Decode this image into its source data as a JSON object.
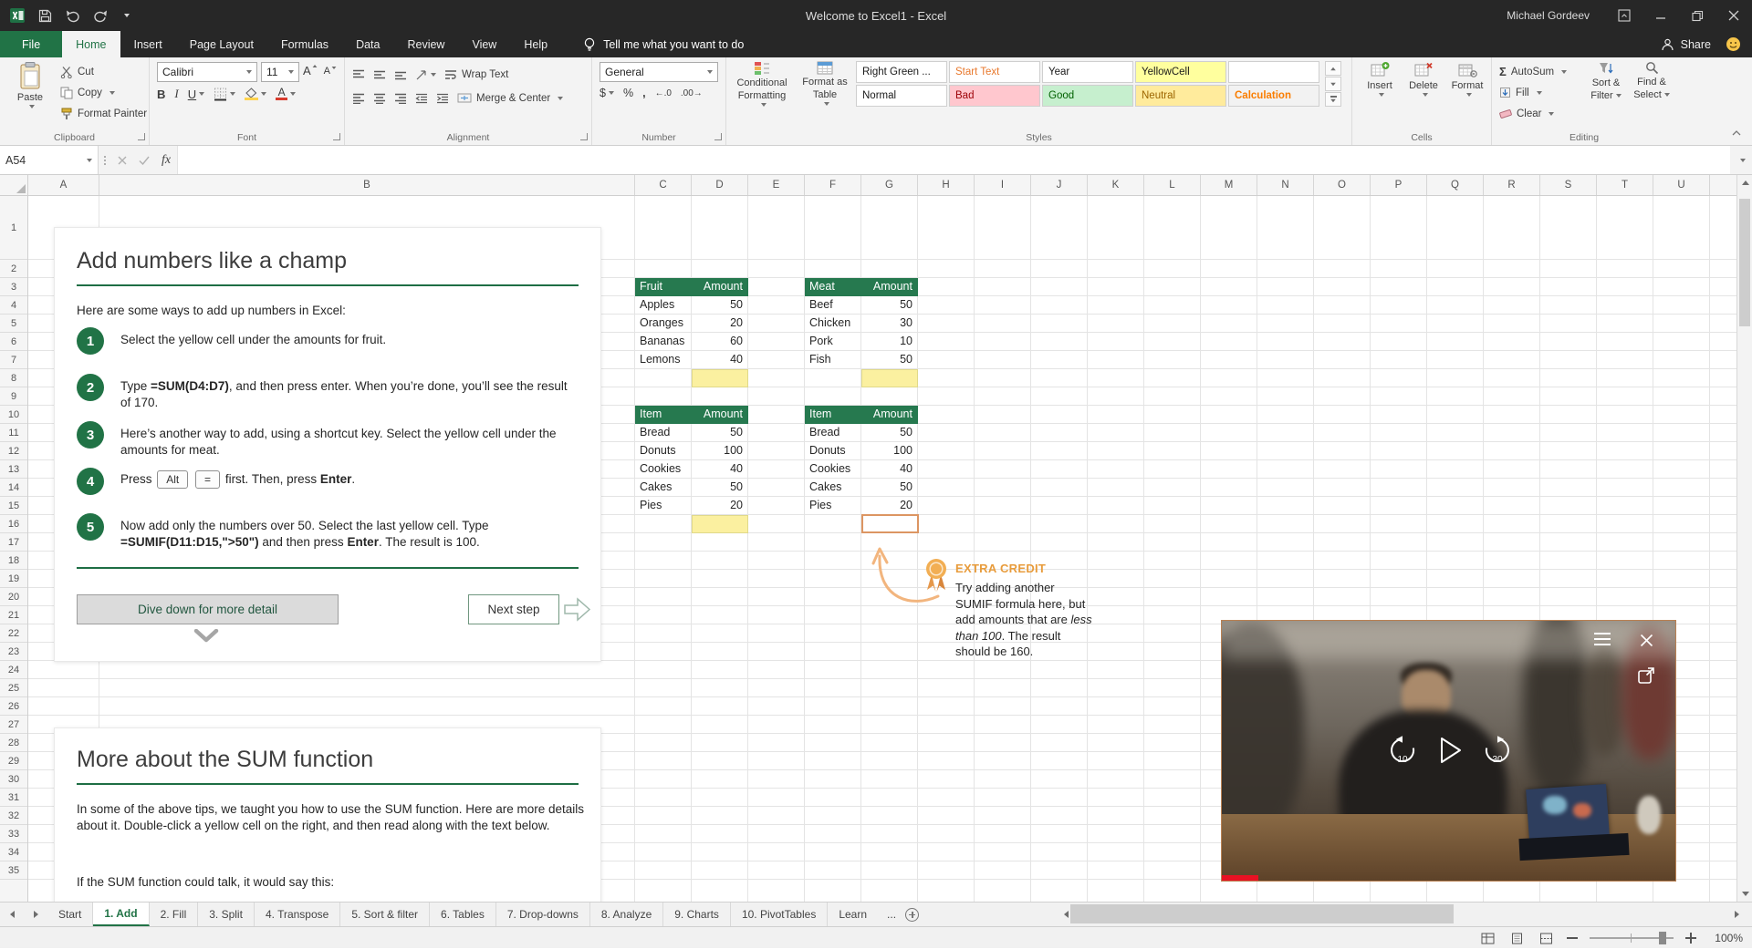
{
  "titlebar": {
    "title": "Welcome to Excel1 - Excel",
    "user": "Michael Gordeev"
  },
  "nav": {
    "file": "File",
    "tabs": [
      "Home",
      "Insert",
      "Page Layout",
      "Formulas",
      "Data",
      "Review",
      "View",
      "Help"
    ],
    "tell_me": "Tell me what you want to do",
    "share": "Share"
  },
  "ribbon": {
    "clipboard": {
      "label": "Clipboard",
      "paste": "Paste",
      "cut": "Cut",
      "copy": "Copy",
      "format_painter": "Format Painter"
    },
    "font": {
      "label": "Font",
      "name": "Calibri",
      "size": "11",
      "bold": "B",
      "italic": "I",
      "underline": "U"
    },
    "alignment": {
      "label": "Alignment",
      "wrap": "Wrap Text",
      "merge": "Merge & Center"
    },
    "number": {
      "label": "Number",
      "format": "General",
      "currency": "$",
      "percent": "%",
      "comma": ",",
      "inc_decimal": "←.0",
      "dec_decimal": ".00→"
    },
    "styles": {
      "label": "Styles",
      "conditional_1": "Conditional",
      "conditional_2": "Formatting",
      "format_table_1": "Format as",
      "format_table_2": "Table",
      "gallery": [
        {
          "name": "Right Green ...",
          "bg": "#ffffff",
          "color": "#1a1a1a",
          "bold": false
        },
        {
          "name": "Start Text",
          "bg": "#ffffff",
          "color": "#e8782c",
          "bold": false
        },
        {
          "name": "Year",
          "bg": "#ffffff",
          "color": "#1a1a1a",
          "bold": false
        },
        {
          "name": "YellowCell",
          "bg": "#ffff9e",
          "color": "#1a1a1a",
          "bold": false
        },
        {
          "name": "",
          "bg": "#ffffff",
          "color": "#1a1a1a",
          "bold": false
        },
        {
          "name": "Normal",
          "bg": "#ffffff",
          "color": "#1a1a1a",
          "bold": false
        },
        {
          "name": "Bad",
          "bg": "#ffc7ce",
          "color": "#9c0006",
          "bold": false
        },
        {
          "name": "Good",
          "bg": "#c6efce",
          "color": "#006100",
          "bold": false
        },
        {
          "name": "Neutral",
          "bg": "#ffeb9c",
          "color": "#9c6500",
          "bold": false
        },
        {
          "name": "Calculation",
          "bg": "#f2f2f2",
          "color": "#fa7d00",
          "bold": true
        }
      ]
    },
    "cells": {
      "label": "Cells",
      "insert": "Insert",
      "delete": "Delete",
      "format": "Format"
    },
    "editing": {
      "label": "Editing",
      "sigma": "Σ",
      "autosum": "AutoSum",
      "fill": "Fill",
      "clear": "Clear",
      "sort_1": "Sort &",
      "sort_2": "Filter",
      "find_1": "Find &",
      "find_2": "Select"
    }
  },
  "formula_bar": {
    "name_box": "A54",
    "fx": "fx",
    "formula": ""
  },
  "grid": {
    "columns": [
      "A",
      "B",
      "C",
      "D",
      "E",
      "F",
      "G",
      "H",
      "I",
      "J",
      "K",
      "L",
      "M",
      "N",
      "O",
      "P",
      "Q",
      "R",
      "S",
      "T",
      "U"
    ],
    "rows": 35
  },
  "content": {
    "card1": {
      "title": "Add numbers like a champ",
      "intro": "Here are some ways to add up numbers in Excel:",
      "step1_n": "1",
      "step1": "Select the yellow cell under the amounts for fruit.",
      "step2_n": "2",
      "step2_a": "Type ",
      "step2_b": "=SUM(D4:D7)",
      "step2_c": ", and then press enter. When you’re done, you’ll see the result of 170.",
      "step3_n": "3",
      "step3": "Here’s another way to add, using a shortcut key. Select the yellow cell under the amounts for meat.",
      "step4_n": "4",
      "step4_a": "Press ",
      "step4_key1": "Alt",
      "step4_key2": "=",
      "step4_b": " first. Then, press ",
      "step4_c": "Enter",
      "step4_d": ".",
      "step5_n": "5",
      "step5_a": "Now add only the numbers over 50. Select the last yellow cell. Type ",
      "step5_b": "=SUMIF(D11:D15,\">50\")",
      "step5_c": " and then press ",
      "step5_d": "Enter",
      "step5_e": ". The result is 100.",
      "dive_button": "Dive down for more detail",
      "next_button": "Next step"
    },
    "tables": {
      "fruit": {
        "h1": "Fruit",
        "h2": "Amount",
        "rows": [
          [
            "Apples",
            "50"
          ],
          [
            "Oranges",
            "20"
          ],
          [
            "Bananas",
            "60"
          ],
          [
            "Lemons",
            "40"
          ]
        ]
      },
      "meat": {
        "h1": "Meat",
        "h2": "Amount",
        "rows": [
          [
            "Beef",
            "50"
          ],
          [
            "Chicken",
            "30"
          ],
          [
            "Pork",
            "10"
          ],
          [
            "Fish",
            "50"
          ]
        ]
      },
      "items1": {
        "h1": "Item",
        "h2": "Amount",
        "rows": [
          [
            "Bread",
            "50"
          ],
          [
            "Donuts",
            "100"
          ],
          [
            "Cookies",
            "40"
          ],
          [
            "Cakes",
            "50"
          ],
          [
            "Pies",
            "20"
          ]
        ]
      },
      "items2": {
        "h1": "Item",
        "h2": "Amount",
        "rows": [
          [
            "Bread",
            "50"
          ],
          [
            "Donuts",
            "100"
          ],
          [
            "Cookies",
            "40"
          ],
          [
            "Cakes",
            "50"
          ],
          [
            "Pies",
            "20"
          ]
        ]
      }
    },
    "extra_credit": {
      "title": "EXTRA CREDIT",
      "t1": "Try adding another SUMIF formula here, but add amounts that are ",
      "t2": "less than 100",
      "t3": ". The result should be 160."
    },
    "card2": {
      "title": "More about the SUM function",
      "p1": "In some of the above tips, we taught you how to use the SUM function. Here are more details about it. Double-click a yellow cell on the right, and then read along with the text below.",
      "p2": "If the SUM function could talk, it would say this:"
    },
    "video": {
      "rewind": "10",
      "forward": "30"
    }
  },
  "sheet_tabs": {
    "items": [
      "Start",
      "1. Add",
      "2. Fill",
      "3. Split",
      "4. Transpose",
      "5. Sort & filter",
      "6. Tables",
      "7. Drop-downs",
      "8. Analyze",
      "9. Charts",
      "10. PivotTables",
      "Learn"
    ],
    "selected": "1. Add",
    "overflow": "..."
  },
  "status_bar": {
    "zoom": "100%"
  },
  "colors": {
    "accent": "#217346",
    "titlebar": "#272727",
    "yellow_cell": "#fbf0a0",
    "table_header": "#26794f",
    "extra_credit_orange": "#e89c3c",
    "progress_red": "#e81123"
  }
}
